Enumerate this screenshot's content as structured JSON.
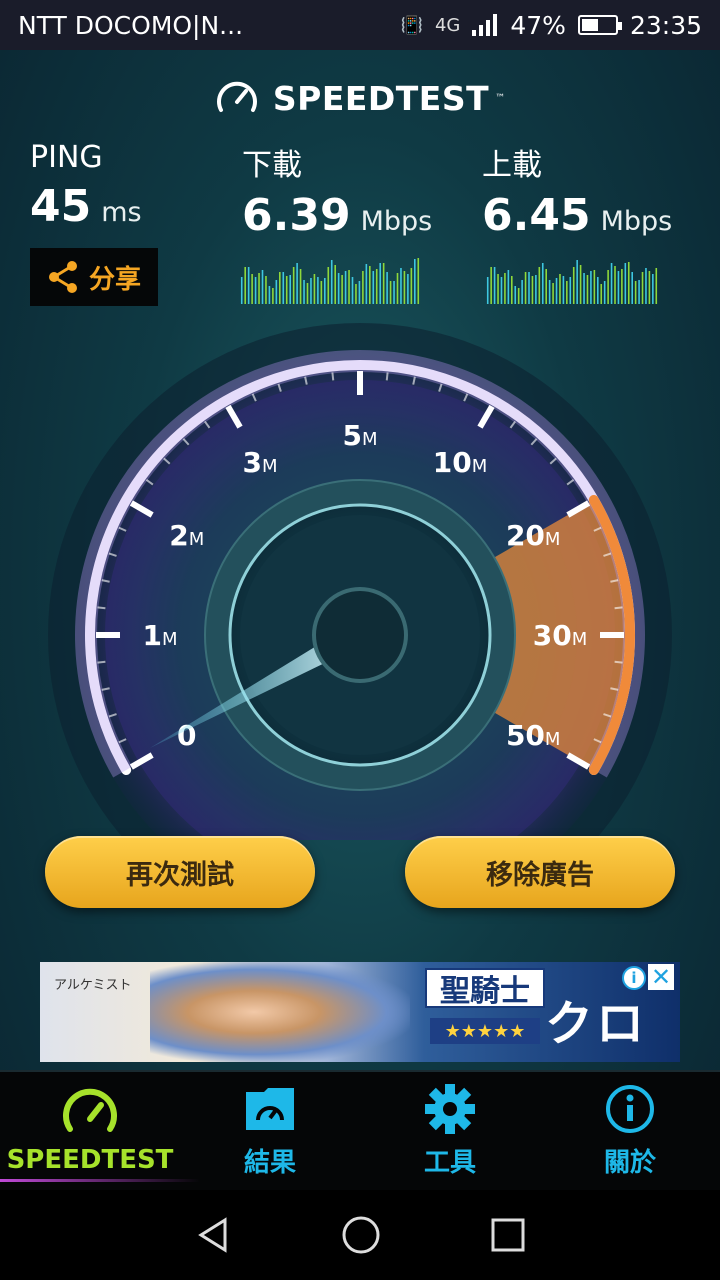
{
  "status_bar": {
    "carrier": "NTT DOCOMO|N...",
    "network": "4G",
    "battery": "47%",
    "time": "23:35"
  },
  "header": {
    "title": "SPEEDTEST",
    "trademark": "™",
    "icon": "speedometer-icon"
  },
  "stats": {
    "ping": {
      "label": "PING",
      "value": "45",
      "unit": "ms"
    },
    "download": {
      "label": "下載",
      "value": "6.39",
      "unit": "Mbps"
    },
    "upload": {
      "label": "上載",
      "value": "6.45",
      "unit": "Mbps"
    }
  },
  "share_button": {
    "label": "分享",
    "icon": "share-icon"
  },
  "gauge": {
    "labels": [
      "0",
      "1M",
      "2M",
      "3M",
      "5M",
      "10M",
      "20M",
      "30M",
      "50M"
    ],
    "needle_value": "0",
    "accent_color": "#e88a3a",
    "ring_color": "#b59cf0"
  },
  "actions": {
    "retest_label": "再次測試",
    "remove_ads_label": "移除廣告"
  },
  "ad": {
    "left_text": "アルケミスト",
    "title": "聖騎士",
    "stars": "★★★★★",
    "name": "クロエ",
    "info_icon": "i",
    "close_icon": "✕"
  },
  "bottom_nav": {
    "items": [
      {
        "label": "SPEEDTEST",
        "icon": "speedometer-icon",
        "active": true
      },
      {
        "label": "結果",
        "icon": "results-folder-icon",
        "active": false
      },
      {
        "label": "工具",
        "icon": "gear-icon",
        "active": false
      },
      {
        "label": "關於",
        "icon": "info-icon",
        "active": false
      }
    ]
  },
  "colors": {
    "accent_orange": "#f5a623",
    "nav_blue": "#1eb8e8",
    "nav_active_green": "#a6e22b"
  }
}
